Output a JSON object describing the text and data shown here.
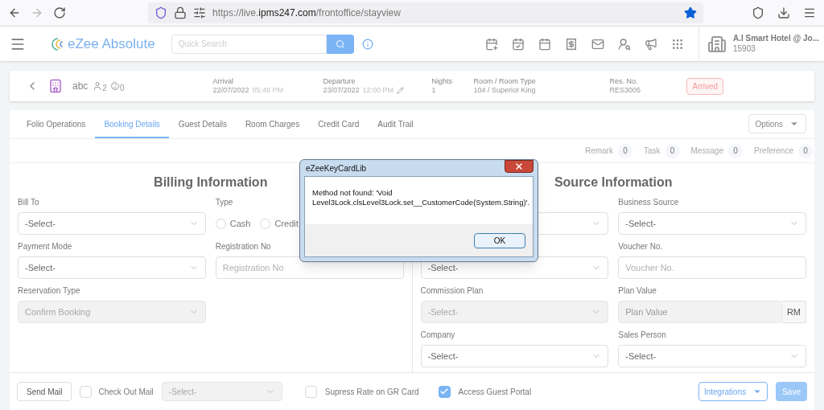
{
  "browser": {
    "url": "https://live.**ipms247.com**/frontoffice/stayview",
    "bookmarked": true
  },
  "header": {
    "logo": "eZee Absolute",
    "search_placeholder": "Quick Search",
    "hotel_name": "A.I Smart Hotel @ Jo...",
    "hotel_id": "15903"
  },
  "reservation": {
    "guest": "abc",
    "adults": "2",
    "children": "0",
    "fields": [
      {
        "label": "Arrival",
        "value": "22/07/2022",
        "time": "05:48 PM"
      },
      {
        "label": "Departure",
        "value": "23/07/2022",
        "time": "12:00 PM",
        "editable": true
      },
      {
        "label": "Nights",
        "value": "1"
      },
      {
        "label": "Room / Room Type",
        "value": "104 / Superior King"
      },
      {
        "label": "Res. No.",
        "value": "RES3005"
      }
    ],
    "status": "Arrived"
  },
  "tabs": [
    {
      "label": "Folio Operations",
      "selected": false
    },
    {
      "label": "Booking Details",
      "selected": true
    },
    {
      "label": "Guest Details",
      "selected": false
    },
    {
      "label": "Room Charges",
      "selected": false
    },
    {
      "label": "Credit Card",
      "selected": false
    },
    {
      "label": "Audit Trail",
      "selected": false
    }
  ],
  "options_button": "Options",
  "counters": [
    {
      "label": "Remark",
      "count": "0"
    },
    {
      "label": "Task",
      "count": "0"
    },
    {
      "label": "Message",
      "count": "0"
    },
    {
      "label": "Preference",
      "count": "0"
    }
  ],
  "billing": {
    "title": "Billing Information",
    "fields": [
      {
        "kind": "select",
        "label": "Bill To",
        "value": "-Select-",
        "disabled": false
      },
      {
        "kind": "radio",
        "label": "Type",
        "options": [
          {
            "label": "Cash",
            "selected": false
          },
          {
            "label": "Credit",
            "selected": false
          }
        ]
      },
      {
        "kind": "select",
        "label": "Payment Mode",
        "value": "-Select-",
        "disabled": false
      },
      {
        "kind": "input",
        "label": "Registration No",
        "placeholder": "Registration No",
        "disabled": false
      },
      {
        "kind": "select",
        "label": "Reservation Type",
        "value": "Confirm Booking",
        "disabled": true
      }
    ]
  },
  "source": {
    "title": "Source Information",
    "fields": [
      {
        "kind": "select",
        "disabled": false
      },
      {
        "kind": "select",
        "label": "Business Source",
        "value": "-Select-",
        "disabled": false
      },
      {
        "kind": "select",
        "value": "-Select-",
        "disabled": false
      },
      {
        "kind": "input",
        "label": "Voucher No.",
        "placeholder": "Voucher No.",
        "disabled": false
      },
      {
        "kind": "select",
        "label": "Commission Plan",
        "value": "-Select-",
        "disabled": true
      },
      {
        "kind": "input",
        "label": "Plan Value",
        "placeholder": "Plan Value",
        "addon": "RM",
        "disabled": true
      },
      {
        "kind": "select",
        "label": "Company",
        "value": "-Select-",
        "disabled": false
      },
      {
        "kind": "select",
        "label": "Sales Person",
        "value": "-Select-",
        "disabled": false
      }
    ]
  },
  "dialog": {
    "title": "eZeeKeyCardLib",
    "message": "Method not found: 'Void Level3Lock.clsLevel3Lock.set__CustomerCode(System.String)'.",
    "button": "OK"
  },
  "footer": {
    "send_mail": "Send Mail",
    "check_out_mail": {
      "label": "Check Out Mail",
      "checked": false
    },
    "mail_select": {
      "value": "-Select-",
      "disabled": true
    },
    "supress_rate": {
      "label": "Supress Rate on GR Card",
      "checked": false
    },
    "guest_portal": {
      "label": "Access Guest Portal",
      "checked": true
    },
    "integrations": "Integrations",
    "save": "Save"
  }
}
